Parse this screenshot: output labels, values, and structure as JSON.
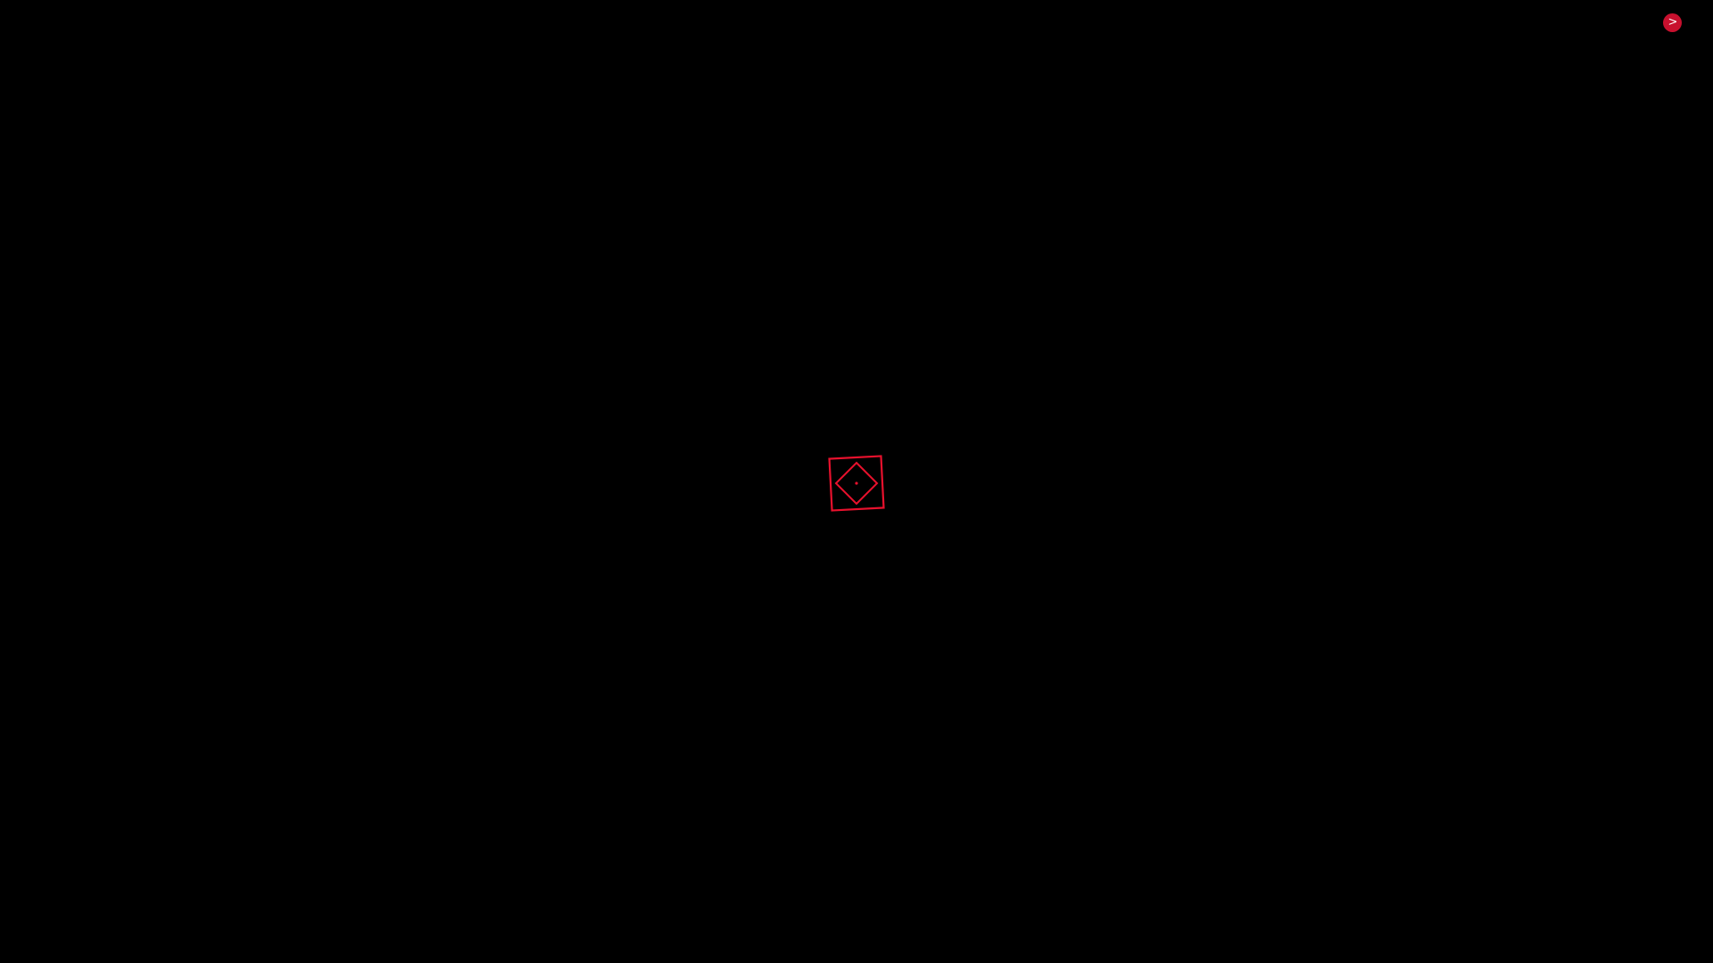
{
  "next_button": {
    "glyph": ">",
    "icon": "chevron-right-icon",
    "color": "#c8102e"
  },
  "reticle": {
    "icon": "diamond-target-icon",
    "color": "#e8112d"
  }
}
